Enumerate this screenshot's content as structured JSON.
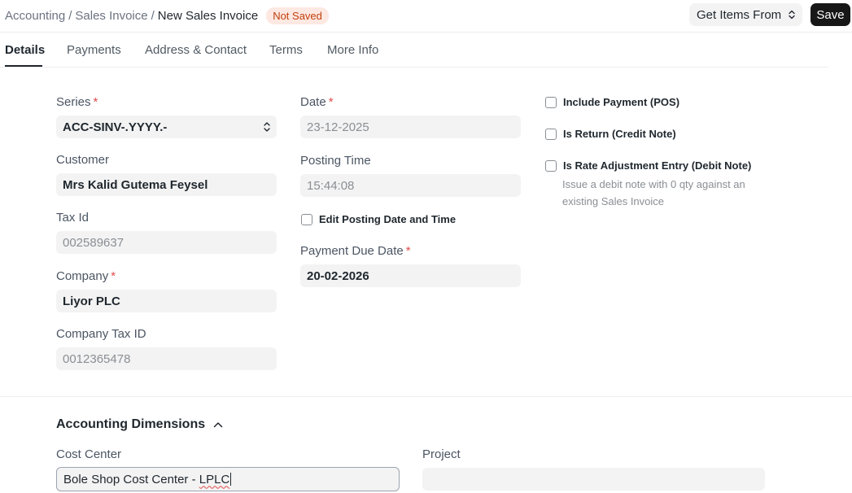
{
  "header": {
    "breadcrumbs": [
      "Accounting",
      "Sales Invoice"
    ],
    "separator": "/",
    "current": "New Sales Invoice",
    "status": "Not Saved",
    "get_items_label": "Get Items From",
    "save_label": "Save"
  },
  "tabs": [
    {
      "label": "Details",
      "active": true
    },
    {
      "label": "Payments",
      "active": false
    },
    {
      "label": "Address & Contact",
      "active": false
    },
    {
      "label": "Terms",
      "active": false
    },
    {
      "label": "More Info",
      "active": false
    }
  ],
  "form": {
    "series": {
      "label": "Series",
      "value": "ACC-SINV-.YYYY.-"
    },
    "customer": {
      "label": "Customer",
      "value": "Mrs Kalid Gutema Feysel"
    },
    "tax_id": {
      "label": "Tax Id",
      "value": "002589637"
    },
    "company": {
      "label": "Company",
      "value": "Liyor PLC"
    },
    "company_tax_id": {
      "label": "Company Tax ID",
      "value": "0012365478"
    },
    "date": {
      "label": "Date",
      "value": "23-12-2025"
    },
    "posting_time": {
      "label": "Posting Time",
      "value": "15:44:08"
    },
    "edit_posting": {
      "label": "Edit Posting Date and Time",
      "checked": false
    },
    "payment_due_date": {
      "label": "Payment Due Date",
      "value": "20-02-2026"
    },
    "include_payment": {
      "label": "Include Payment (POS)",
      "checked": false
    },
    "is_return": {
      "label": "Is Return (Credit Note)",
      "checked": false
    },
    "is_rate_adjustment": {
      "label": "Is Rate Adjustment Entry (Debit Note)",
      "checked": false,
      "help": "Issue a debit note with 0 qty against an existing Sales Invoice"
    },
    "required_mark": "*"
  },
  "accounting_dimensions": {
    "title": "Accounting Dimensions",
    "cost_center": {
      "label": "Cost Center",
      "value_main": "Bole Shop Cost Center - ",
      "value_flagged": "LPLC"
    },
    "project": {
      "label": "Project",
      "value": ""
    }
  },
  "icons": {
    "select_caret": "updown-chevron-icon",
    "section_toggle": "chevron-up-icon"
  },
  "colors": {
    "primary_button": "#171717",
    "status_badge_bg": "#fde8e2",
    "status_badge_text": "#c2410c",
    "required": "#e24c4c",
    "field_bg": "#f3f3f3"
  }
}
